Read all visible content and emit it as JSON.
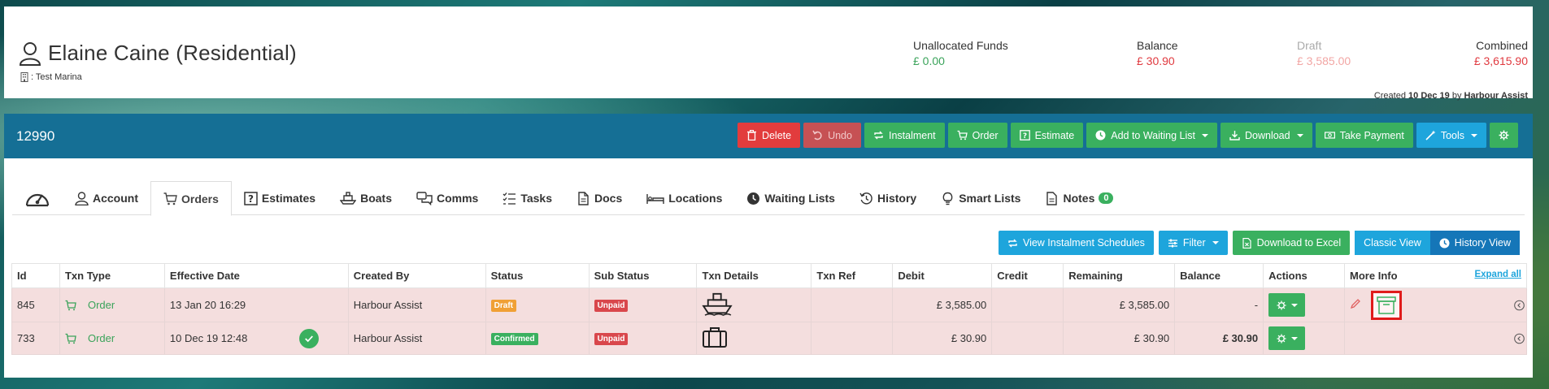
{
  "header": {
    "customer_name": "Elaine Caine (Residential)",
    "marina_label": ": Test Marina",
    "funds": {
      "unallocated_label": "Unallocated Funds",
      "unallocated_value": "£ 0.00",
      "balance_label": "Balance",
      "balance_value": "£ 30.90",
      "draft_label": "Draft",
      "draft_value": "£ 3,585.00",
      "combined_label": "Combined",
      "combined_value": "£ 3,615.90"
    },
    "created_prefix": "Created",
    "created_date": "10 Dec 19",
    "created_by_prefix": "by",
    "created_by": "Harbour Assist"
  },
  "record": {
    "id": "12990"
  },
  "toolbar": {
    "delete": "Delete",
    "undo": "Undo",
    "instalment": "Instalment",
    "order": "Order",
    "estimate": "Estimate",
    "waiting_list": "Add to Waiting List",
    "download": "Download",
    "take_payment": "Take Payment",
    "tools": "Tools"
  },
  "tabs": [
    {
      "label": ""
    },
    {
      "label": "Account"
    },
    {
      "label": "Orders"
    },
    {
      "label": "Estimates"
    },
    {
      "label": "Boats"
    },
    {
      "label": "Comms"
    },
    {
      "label": "Tasks"
    },
    {
      "label": "Docs"
    },
    {
      "label": "Locations"
    },
    {
      "label": "Waiting Lists"
    },
    {
      "label": "History"
    },
    {
      "label": "Smart Lists"
    },
    {
      "label": "Notes",
      "badge": "0"
    }
  ],
  "actions": {
    "instalment_schedules": "View Instalment Schedules",
    "filter": "Filter",
    "excel": "Download to Excel",
    "classic_view": "Classic View",
    "history_view": "History View"
  },
  "table": {
    "headers": {
      "id": "Id",
      "txn_type": "Txn Type",
      "effective_date": "Effective Date",
      "created_by": "Created By",
      "status": "Status",
      "sub_status": "Sub Status",
      "txn_details": "Txn Details",
      "txn_ref": "Txn Ref",
      "debit": "Debit",
      "credit": "Credit",
      "remaining": "Remaining",
      "balance": "Balance",
      "actions": "Actions",
      "more_info": "More Info",
      "expand_all": "Expand all"
    },
    "rows": [
      {
        "id": "845",
        "txn_type": "Order",
        "effective_date": "13 Jan 20 16:29",
        "created_by": "Harbour Assist",
        "status": "Draft",
        "sub_status": "Unpaid",
        "txn_ref": "",
        "debit": "£ 3,585.00",
        "credit": "",
        "remaining": "£ 3,585.00",
        "balance": "-"
      },
      {
        "id": "733",
        "txn_type": "Order",
        "effective_date": "10 Dec 19 12:48",
        "created_by": "Harbour Assist",
        "status": "Confirmed",
        "sub_status": "Unpaid",
        "txn_ref": "",
        "debit": "£ 30.90",
        "credit": "",
        "remaining": "£ 30.90",
        "balance": "£ 30.90"
      }
    ]
  },
  "colors": {
    "primary_bar": "#156f95",
    "green": "#3ab05f",
    "red": "#e23c3d",
    "cyan": "#1ea5dc",
    "row_highlight": "#f4dede"
  }
}
